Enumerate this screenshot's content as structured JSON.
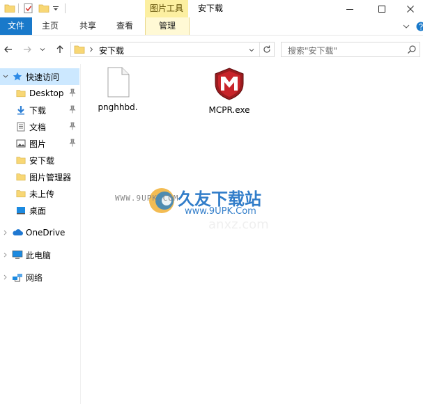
{
  "window": {
    "title": "安下载",
    "contextual_tab_group": "图片工具"
  },
  "ribbon": {
    "tabs": [
      {
        "label": "文件"
      },
      {
        "label": "主页"
      },
      {
        "label": "共享"
      },
      {
        "label": "查看"
      },
      {
        "label": "管理"
      }
    ]
  },
  "address": {
    "path": "安下载",
    "search_placeholder": "搜索\"安下载\""
  },
  "nav": {
    "quick_access": "快速访问",
    "items": [
      {
        "label": "Desktop",
        "icon": "folder-icon",
        "pinned": true
      },
      {
        "label": "下载",
        "icon": "download-icon",
        "pinned": true
      },
      {
        "label": "文档",
        "icon": "document-icon",
        "pinned": true
      },
      {
        "label": "图片",
        "icon": "picture-icon",
        "pinned": true
      },
      {
        "label": "安下载",
        "icon": "folder-icon",
        "pinned": false
      },
      {
        "label": "图片管理器",
        "icon": "folder-icon",
        "pinned": false
      },
      {
        "label": "未上传",
        "icon": "folder-icon",
        "pinned": false
      },
      {
        "label": "桌面",
        "icon": "desktop-icon",
        "pinned": false
      }
    ],
    "onedrive": "OneDrive",
    "this_pc": "此电脑",
    "network": "网络"
  },
  "files": [
    {
      "name": "pnghhbd.",
      "icon": "blank-file-icon"
    },
    {
      "name": "MCPR.exe",
      "icon": "mcafee-shield-icon"
    }
  ],
  "watermark": {
    "url_left": "WWW.9UPK.COM",
    "brand": "久友下载站",
    "url_right": "www.9UPK.Com",
    "ghost": "anxz.com"
  },
  "colors": {
    "file_tab": "#1979ca",
    "selection": "#cce8ff",
    "context_tab": "#fcefa1",
    "folder": "#f8d775"
  }
}
